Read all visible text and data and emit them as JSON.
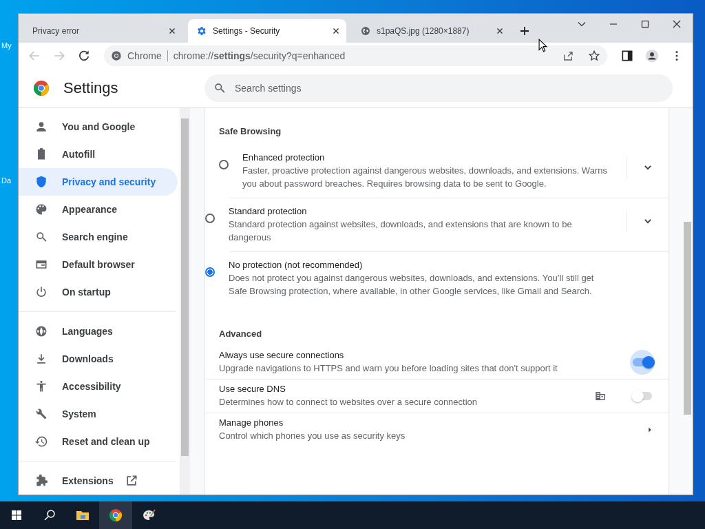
{
  "desktop": {
    "labels": [
      "My",
      "Da"
    ]
  },
  "tabs": [
    {
      "title": "Privacy error",
      "selected": false
    },
    {
      "title": "Settings - Security",
      "selected": true
    },
    {
      "title": "s1paQS.jpg (1280×1887)",
      "selected": false
    }
  ],
  "toolbar": {
    "back_disabled": true,
    "forward_disabled": true,
    "site_label": "Chrome",
    "url": "chrome://**settings**/security?q=enhanced"
  },
  "header": {
    "title": "Settings",
    "search": {
      "placeholder": "Search settings"
    }
  },
  "sidebar": {
    "groups": [
      [
        {
          "label": "You and Google",
          "selected": false,
          "kind": "page"
        },
        {
          "label": "Autofill",
          "selected": false,
          "kind": "page"
        },
        {
          "label": "Privacy and security",
          "selected": true,
          "kind": "page"
        },
        {
          "label": "Appearance",
          "selected": false,
          "kind": "page"
        },
        {
          "label": "Search engine",
          "selected": false,
          "kind": "page"
        },
        {
          "label": "Default browser",
          "selected": false,
          "kind": "page"
        },
        {
          "label": "On startup",
          "selected": false,
          "kind": "page"
        }
      ],
      [
        {
          "label": "Languages",
          "selected": false,
          "kind": "page"
        },
        {
          "label": "Downloads",
          "selected": false,
          "kind": "page"
        },
        {
          "label": "Accessibility",
          "selected": false,
          "kind": "page"
        },
        {
          "label": "System",
          "selected": false,
          "kind": "page"
        },
        {
          "label": "Reset and clean up",
          "selected": false,
          "kind": "page"
        }
      ],
      [
        {
          "label": "Extensions",
          "selected": false,
          "kind": "external"
        }
      ]
    ]
  },
  "safe_browsing": {
    "heading": "Safe Browsing",
    "options": [
      {
        "title": "Enhanced protection",
        "description": "Faster, proactive protection against dangerous websites, downloads, and extensions. Warns you about password breaches. Requires browsing data to be sent to Google.",
        "selected": false,
        "expandable": true
      },
      {
        "title": "Standard protection",
        "description": "Standard protection against websites, downloads, and extensions that are known to be dangerous",
        "selected": false,
        "expandable": true
      },
      {
        "title": "No protection (not recommended)",
        "description": "Does not protect you against dangerous websites, downloads, and extensions. You’ll still get Safe Browsing protection, where available, in other Google services, like Gmail and Search.",
        "selected": true,
        "expandable": false
      }
    ]
  },
  "advanced": {
    "heading": "Advanced",
    "rows": [
      {
        "kind": "toggle",
        "title": "Always use secure connections",
        "description": "Upgrade navigations to HTTPS and warn you before loading sites that don't support it",
        "on": true,
        "managed": false,
        "focused": true
      },
      {
        "kind": "toggle",
        "title": "Use secure DNS",
        "description": "Determines how to connect to websites over a secure connection",
        "on": false,
        "managed": true,
        "focused": false
      },
      {
        "kind": "link",
        "title": "Manage phones",
        "description": "Control which phones you use as security keys"
      }
    ]
  },
  "taskbar": [
    {
      "selected": false
    },
    {
      "selected": false
    },
    {
      "selected": false
    },
    {
      "selected": true
    },
    {
      "selected": false
    }
  ]
}
